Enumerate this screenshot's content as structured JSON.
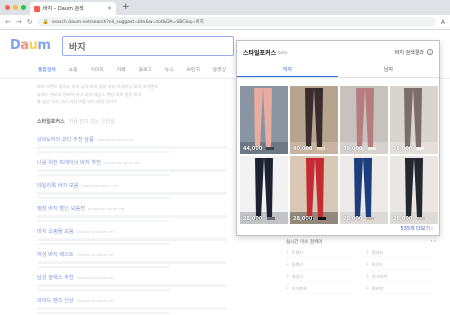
{
  "browser": {
    "tab_title": "바지 – Daum 검색",
    "tab_close": "×",
    "new_tab": "+",
    "url": "search.daum.net/search?nil_suggest=btn&w=tot&DA=SBC&q=바지",
    "traffic_colors": [
      "#ff5f57",
      "#febc2e",
      "#28c840"
    ]
  },
  "header": {
    "logo_letters": [
      "D",
      "a",
      "u",
      "m"
    ],
    "logo_colors": [
      "#3b73e6",
      "#ee5a44",
      "#f5b800",
      "#3b73e6"
    ],
    "search_value": "바지"
  },
  "gnb": [
    "통합검색",
    "쇼핑",
    "이미지",
    "카페",
    "블로그",
    "뉴스",
    "브런치",
    "동영상"
  ],
  "related": [
    "바지 브랜드   와이드 바지   남자 바지   여자 바지   트레이닝 바지   조거팬츠",
    "슬랙스   청바지   면바지   카고 바지   레깅스   밴딩 바지   정장 바지",
    "통 넓은 바지   기모 바지   겨울 바지   바지 사이즈"
  ],
  "section": {
    "title": "스타일포커스",
    "note": "지금 인기 있는 스타일"
  },
  "results": [
    {
      "title": "상의&하의 코디 추천 상품",
      "url": "shopping.daum.net"
    },
    {
      "title": "나를 위한 트레이닝 바지 추천",
      "url": "shopping.daum.net"
    },
    {
      "title": "데일리룩 바지 모음",
      "url": "shopping.daum.net"
    },
    {
      "title": "정장 바지 할인 모음전",
      "url": "shopping.daum.net"
    },
    {
      "title": "바지 쇼핑몰 모음",
      "url": "shopping.daum.net"
    },
    {
      "title": "여성 바지 베스트",
      "url": "shopping.daum.net"
    },
    {
      "title": "남성 슬랙스 추천",
      "url": "shopping.daum.net"
    },
    {
      "title": "와이드 팬츠 신상",
      "url": "shopping.daum.net"
    }
  ],
  "mini_panel": {
    "title": "실시간 이슈 검색어",
    "nav": "‹ ›",
    "items": [
      "트렌드",
      "청바지",
      "슬랙스",
      "와이드",
      "레깅스",
      "카고바지",
      "조거팬츠",
      "면바지"
    ]
  },
  "popup": {
    "title": "스타일포커스",
    "beta": "beta",
    "settings_label": "바지 검색결과",
    "info_glyph": "i",
    "tabs": [
      "여자",
      "남자"
    ],
    "active_tab": 0,
    "more_label": "535개 더보기",
    "more_arrow": "›",
    "items": [
      {
        "price": "44,000",
        "bg": "#8a95a3",
        "fg": "#e8aca0",
        "accent": "#3d4450"
      },
      {
        "price": "40,000",
        "bg": "#b7a48e",
        "fg": "#3a2b2c",
        "accent": "#e8d8c6"
      },
      {
        "price": "39,000",
        "bg": "#c8c2bd",
        "fg": "#b57d7f",
        "accent": "#f2eeea"
      },
      {
        "price": "28,000",
        "bg": "#d8d4cf",
        "fg": "#7a6d6a",
        "accent": "#f5f3f0"
      },
      {
        "price": "28,000",
        "bg": "#f2f2f2",
        "fg": "#1d2230",
        "accent": "#6b6e74"
      },
      {
        "price": "28,000",
        "bg": "#d9c8b6",
        "fg": "#c62a33",
        "accent": "#111111"
      },
      {
        "price": "28,000",
        "bg": "#ece9e6",
        "fg": "#1d3d7d",
        "accent": "#bfbcb8"
      },
      {
        "price": "28,000",
        "bg": "#e9e6e4",
        "fg": "#24272d",
        "accent": "#c9c6c2"
      }
    ]
  }
}
